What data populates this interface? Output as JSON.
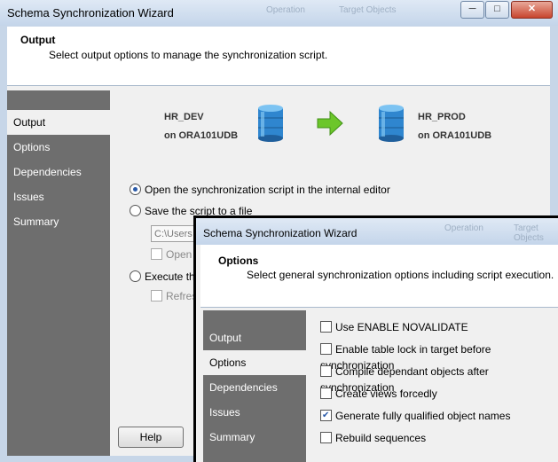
{
  "back_window": {
    "title": "Schema Synchronization Wizard",
    "ghost_labels": [
      "Operation",
      "Target Objects"
    ],
    "controls": {
      "minimize": "─",
      "maximize": "□",
      "close": "✕"
    },
    "header": {
      "title": "Output",
      "subtitle": "Select output options to manage the synchronization script."
    },
    "nav": [
      "Output",
      "Options",
      "Dependencies",
      "Issues",
      "Summary"
    ],
    "source": {
      "schema": "HR_DEV",
      "server": "on ORA101UDB"
    },
    "target": {
      "schema": "HR_PROD",
      "server": "on ORA101UDB"
    },
    "radio_open_internal": "Open the synchronization script in the internal editor",
    "radio_save_file": "Save the script to a file",
    "path_value": "C:\\Users",
    "check_open": "Open",
    "radio_execute": "Execute the",
    "check_refresh": "Refres",
    "help_button": "Help",
    "colors": {
      "nav_bg": "#6e6e6e",
      "arrow": "#6cc62a",
      "db_icon": "#2f86cf"
    }
  },
  "front_window": {
    "title": "Schema Synchronization Wizard",
    "ghost_labels": [
      "Operation",
      "Target Objects"
    ],
    "header": {
      "title": "Options",
      "subtitle": "Select general synchronization options including script execution."
    },
    "nav": [
      "Output",
      "Options",
      "Dependencies",
      "Issues",
      "Summary"
    ],
    "options": [
      {
        "label": "Use ENABLE NOVALIDATE",
        "checked": false
      },
      {
        "label": "Enable table lock in target before synchronization",
        "checked": false
      },
      {
        "label": "Compile dependant objects after synchronization",
        "checked": false
      },
      {
        "label": "Create views forcedly",
        "checked": false
      },
      {
        "label": "Generate fully qualified object names",
        "checked": true
      },
      {
        "label": "Rebuild sequences",
        "checked": false
      }
    ]
  }
}
